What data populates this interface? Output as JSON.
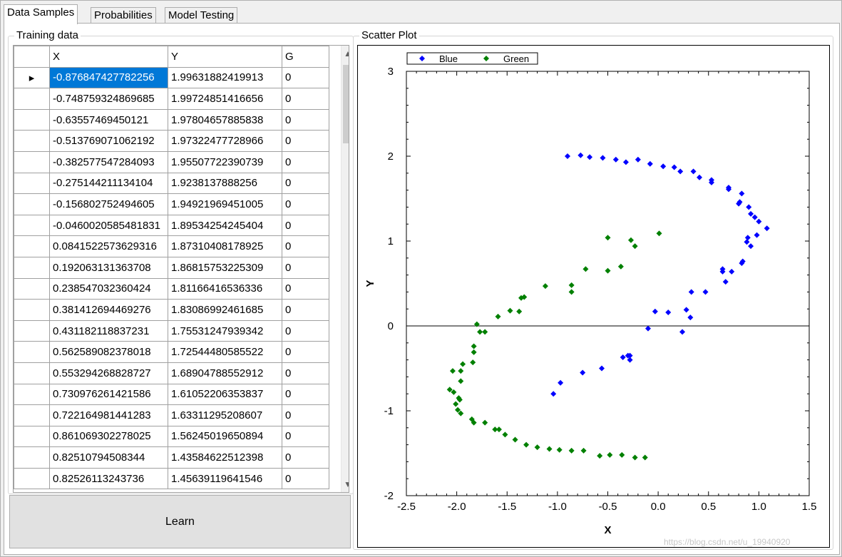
{
  "tabs": [
    {
      "label": "Data Samples",
      "active": true
    },
    {
      "label": "Probabilities",
      "active": false
    },
    {
      "label": "Model Testing",
      "active": false
    }
  ],
  "training": {
    "group_label": "Training data",
    "columns": [
      "X",
      "Y",
      "G"
    ],
    "rows": [
      [
        "-0.876847427782256",
        "1.99631882419913",
        "0"
      ],
      [
        "-0.748759324869685",
        "1.99724851416656",
        "0"
      ],
      [
        "-0.63557469450121",
        "1.97804657885838",
        "0"
      ],
      [
        "-0.513769071062192",
        "1.97322477728966",
        "0"
      ],
      [
        "-0.382577547284093",
        "1.95507722390739",
        "0"
      ],
      [
        "-0.275144211134104",
        "1.9238137888256",
        "0"
      ],
      [
        "-0.156802752494605",
        "1.94921969451005",
        "0"
      ],
      [
        "-0.0460020585481831",
        "1.89534254245404",
        "0"
      ],
      [
        "0.0841522573629316",
        "1.87310408178925",
        "0"
      ],
      [
        "0.192063131363708",
        "1.86815753225309",
        "0"
      ],
      [
        "0.238547032360424",
        "1.81166416536336",
        "0"
      ],
      [
        "0.381412694469276",
        "1.83086992461685",
        "0"
      ],
      [
        "0.431182118837231",
        "1.75531247939342",
        "0"
      ],
      [
        "0.562589082378018",
        "1.72544480585522",
        "0"
      ],
      [
        "0.553294268828727",
        "1.68904788552912",
        "0"
      ],
      [
        "0.730976261421586",
        "1.61052206353837",
        "0"
      ],
      [
        "0.722164981441283",
        "1.63311295208607",
        "0"
      ],
      [
        "0.861069302278025",
        "1.56245019650894",
        "0"
      ],
      [
        "0.82510794508344",
        "1.43584622512398",
        "0"
      ],
      [
        "0.82526113243736",
        "1.45639119641546",
        "0"
      ]
    ]
  },
  "learn_button": "Learn",
  "plot": {
    "group_label": "Scatter Plot",
    "watermark": "https://blog.csdn.net/u_19940920"
  },
  "chart_data": {
    "type": "scatter",
    "title": "",
    "xlabel": "X",
    "ylabel": "Y",
    "xlim": [
      -2.5,
      1.5
    ],
    "ylim": [
      -2,
      3
    ],
    "xticks": [
      "-2.5",
      "-2.0",
      "-1.5",
      "-1.0",
      "-0.5",
      "0.0",
      "0.5",
      "1.0",
      "1.5"
    ],
    "yticks": [
      "-2",
      "-1",
      "0",
      "1",
      "2",
      "3"
    ],
    "legend_position": "top-left",
    "series": [
      {
        "name": "Blue",
        "color": "#0000ff",
        "points": [
          [
            -0.9,
            2.0
          ],
          [
            -0.77,
            2.01
          ],
          [
            -0.68,
            1.99
          ],
          [
            -0.55,
            1.98
          ],
          [
            -0.42,
            1.96
          ],
          [
            -0.32,
            1.93
          ],
          [
            -0.2,
            1.96
          ],
          [
            -0.08,
            1.91
          ],
          [
            0.05,
            1.88
          ],
          [
            0.16,
            1.87
          ],
          [
            0.22,
            1.82
          ],
          [
            0.35,
            1.82
          ],
          [
            0.41,
            1.75
          ],
          [
            0.53,
            1.72
          ],
          [
            0.53,
            1.69
          ],
          [
            0.7,
            1.63
          ],
          [
            0.7,
            1.61
          ],
          [
            0.83,
            1.56
          ],
          [
            0.81,
            1.46
          ],
          [
            0.8,
            1.44
          ],
          [
            0.9,
            1.4
          ],
          [
            0.92,
            1.32
          ],
          [
            0.96,
            1.28
          ],
          [
            1.0,
            1.23
          ],
          [
            1.08,
            1.15
          ],
          [
            0.98,
            1.07
          ],
          [
            0.89,
            1.04
          ],
          [
            0.88,
            0.99
          ],
          [
            0.92,
            0.94
          ],
          [
            0.84,
            0.76
          ],
          [
            0.83,
            0.74
          ],
          [
            0.64,
            0.67
          ],
          [
            0.64,
            0.64
          ],
          [
            0.73,
            0.64
          ],
          [
            0.67,
            0.52
          ],
          [
            0.47,
            0.4
          ],
          [
            0.33,
            0.4
          ],
          [
            0.32,
            0.1
          ],
          [
            0.28,
            0.19
          ],
          [
            0.24,
            -0.07
          ],
          [
            0.1,
            0.16
          ],
          [
            -0.03,
            0.17
          ],
          [
            -0.1,
            -0.03
          ],
          [
            -0.3,
            -0.35
          ],
          [
            -0.28,
            -0.35
          ],
          [
            -0.28,
            -0.4
          ],
          [
            -0.35,
            -0.37
          ],
          [
            -0.56,
            -0.5
          ],
          [
            -0.75,
            -0.55
          ],
          [
            -0.97,
            -0.67
          ],
          [
            -1.04,
            -0.8
          ]
        ]
      },
      {
        "name": "Green",
        "color": "#008000",
        "points": [
          [
            -0.5,
            1.04
          ],
          [
            -0.27,
            1.01
          ],
          [
            0.01,
            1.09
          ],
          [
            -0.23,
            0.94
          ],
          [
            -0.5,
            0.65
          ],
          [
            -0.37,
            0.7
          ],
          [
            -0.72,
            0.67
          ],
          [
            -1.12,
            0.47
          ],
          [
            -0.86,
            0.48
          ],
          [
            -0.86,
            0.4
          ],
          [
            -1.33,
            0.34
          ],
          [
            -1.36,
            0.33
          ],
          [
            -1.38,
            0.17
          ],
          [
            -1.47,
            0.18
          ],
          [
            -1.59,
            0.11
          ],
          [
            -1.8,
            0.02
          ],
          [
            -1.77,
            -0.07
          ],
          [
            -1.72,
            -0.07
          ],
          [
            -1.83,
            -0.24
          ],
          [
            -1.83,
            -0.31
          ],
          [
            -1.84,
            -0.43
          ],
          [
            -1.94,
            -0.45
          ],
          [
            -1.96,
            -0.53
          ],
          [
            -2.04,
            -0.53
          ],
          [
            -1.96,
            -0.65
          ],
          [
            -2.07,
            -0.75
          ],
          [
            -2.03,
            -0.78
          ],
          [
            -1.98,
            -0.85
          ],
          [
            -1.97,
            -0.87
          ],
          [
            -2.01,
            -0.92
          ],
          [
            -1.99,
            -0.99
          ],
          [
            -1.96,
            -1.03
          ],
          [
            -1.85,
            -1.1
          ],
          [
            -1.83,
            -1.14
          ],
          [
            -1.72,
            -1.14
          ],
          [
            -1.62,
            -1.22
          ],
          [
            -1.58,
            -1.22
          ],
          [
            -1.52,
            -1.28
          ],
          [
            -1.42,
            -1.34
          ],
          [
            -1.31,
            -1.4
          ],
          [
            -1.2,
            -1.43
          ],
          [
            -1.08,
            -1.45
          ],
          [
            -0.98,
            -1.46
          ],
          [
            -0.86,
            -1.47
          ],
          [
            -0.74,
            -1.47
          ],
          [
            -0.58,
            -1.53
          ],
          [
            -0.48,
            -1.52
          ],
          [
            -0.36,
            -1.52
          ],
          [
            -0.23,
            -1.55
          ],
          [
            -0.13,
            -1.55
          ]
        ]
      }
    ]
  }
}
